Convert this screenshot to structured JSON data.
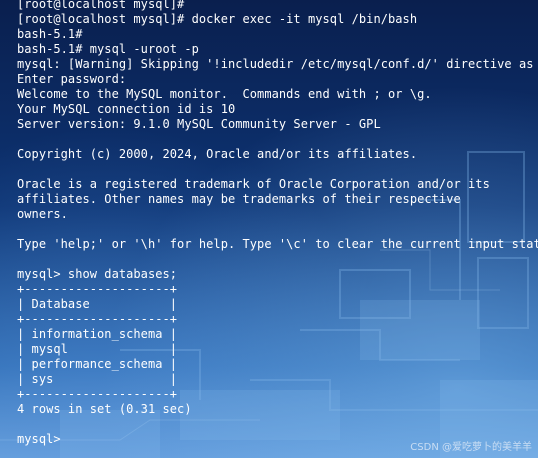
{
  "terminal": {
    "lines": [
      "[root@localhost mysql]#",
      "[root@localhost mysql]# docker exec -it mysql /bin/bash",
      "bash-5.1#",
      "bash-5.1# mysql -uroot -p",
      "mysql: [Warning] Skipping '!includedir /etc/mysql/conf.d/' directive as max",
      "Enter password:",
      "Welcome to the MySQL monitor.  Commands end with ; or \\g.",
      "Your MySQL connection id is 10",
      "Server version: 9.1.0 MySQL Community Server - GPL",
      "",
      "Copyright (c) 2000, 2024, Oracle and/or its affiliates.",
      "",
      "Oracle is a registered trademark of Oracle Corporation and/or its",
      "affiliates. Other names may be trademarks of their respective",
      "owners.",
      "",
      "Type 'help;' or '\\h' for help. Type '\\c' to clear the current input stateme",
      "",
      "mysql> show databases;",
      "+--------------------+",
      "| Database           |",
      "+--------------------+",
      "| information_schema |",
      "| mysql              |",
      "| performance_schema |",
      "| sys                |",
      "+--------------------+",
      "4 rows in set (0.31 sec)",
      "",
      "mysql>"
    ]
  },
  "watermark": "CSDN @爱吃萝卜的美羊羊",
  "colors": {
    "text": "#ffffff",
    "background_dark": "#0a1f4e",
    "background_light": "#6aa2de"
  }
}
